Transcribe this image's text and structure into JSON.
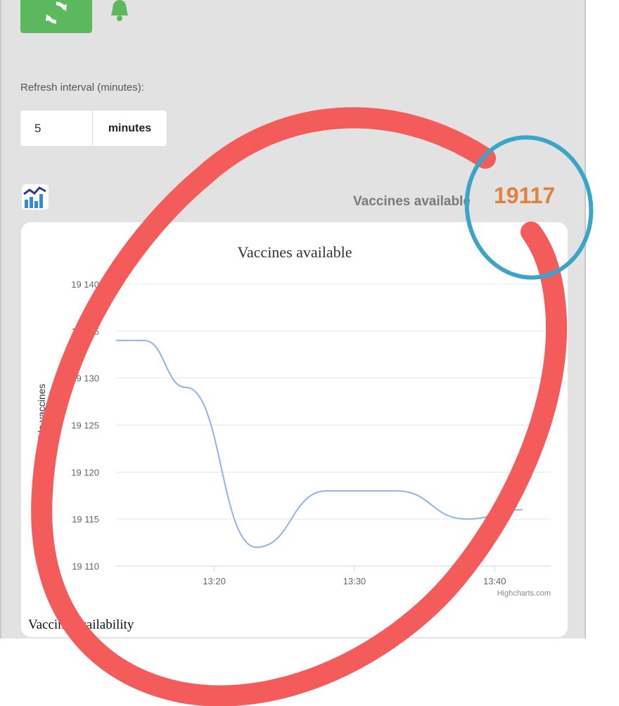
{
  "controls": {
    "refresh_icon": "refresh-icon",
    "bell_icon": "bell-icon",
    "refresh_interval_label": "Refresh interval (minutes):",
    "interval_value": "5",
    "interval_unit": "minutes"
  },
  "summary": {
    "chart_icon": "chart-icon",
    "label": "Vaccines available",
    "count": "19117"
  },
  "caption": "Vaccine availability",
  "credits": "Highcharts.com",
  "colors": {
    "accent_green": "#5cb85c",
    "count_orange": "#e0813c",
    "series_line": "#90b4e6"
  },
  "chart_data": {
    "type": "line",
    "title": "Vaccines available",
    "ylabel": "number of available vaccines",
    "xlabel": "",
    "ylim": [
      19110,
      19140
    ],
    "yticks": [
      19110,
      19115,
      19120,
      19125,
      19130,
      19135,
      19140
    ],
    "ytick_labels": [
      "19 110",
      "19 115",
      "19 120",
      "19 125",
      "19 130",
      "19 135",
      "19 140"
    ],
    "xlim": [
      "13:13",
      "13:44"
    ],
    "xticks": [
      "13:20",
      "13:30",
      "13:40"
    ],
    "series": [
      {
        "x": [
          "13:13",
          "13:15",
          "13:18",
          "13:23",
          "13:28",
          "13:33",
          "13:38",
          "13:42"
        ],
        "values": [
          19134,
          19134,
          19129,
          19112,
          19118,
          19118,
          19115,
          19116
        ]
      }
    ]
  }
}
